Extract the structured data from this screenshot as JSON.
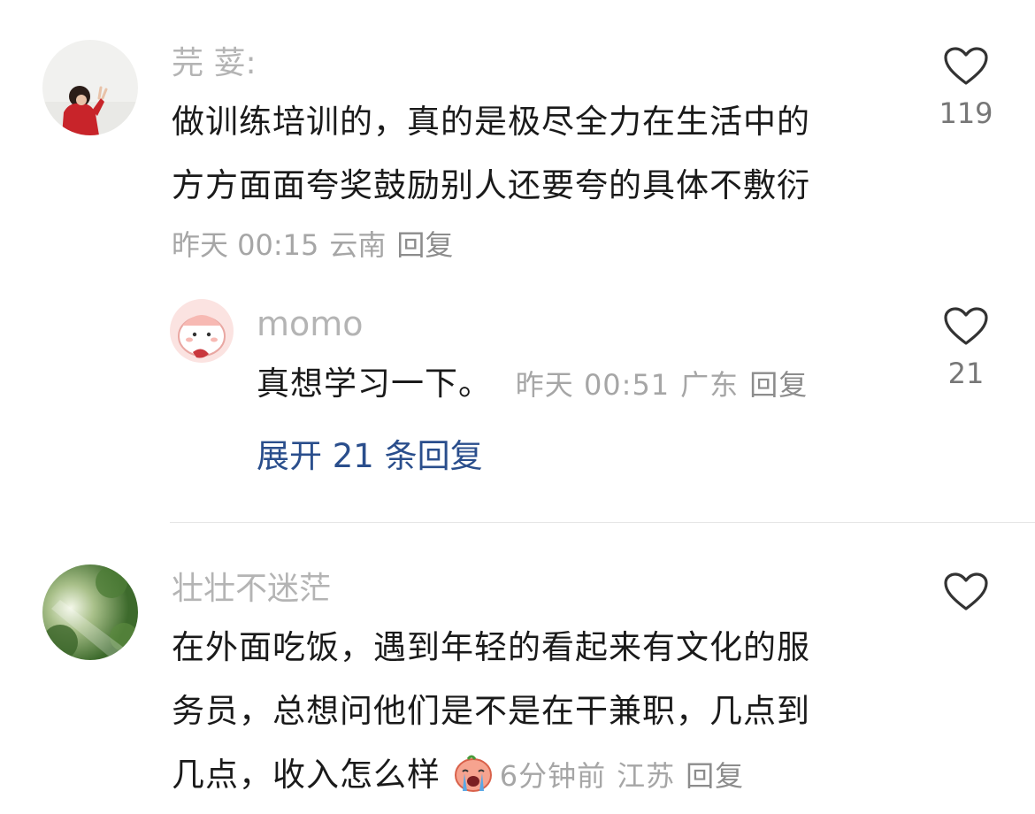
{
  "comments": [
    {
      "username": "芫 荽:",
      "text_line1": "做训练培训的，真的是极尽全力在生活中的",
      "text_line2": "方方面面夸奖鼓励别人还要夸的具体不敷衍",
      "time": "昨天 00:15",
      "location": "云南",
      "reply_label": "回复",
      "like_count": "119",
      "avatar_icon": "person-red-jacket-avatar"
    },
    {
      "username": "壮壮不迷茫",
      "text_line1": "在外面吃饭，遇到年轻的看起来有文化的服",
      "text_line2": "务员，总想问他们是不是在干兼职，几点到",
      "text_line3": "几点，收入怎么样",
      "emoji_icon": "crying-emoji-icon",
      "time": "6分钟前",
      "location": "江苏",
      "reply_label": "回复",
      "avatar_icon": "forest-sunlight-avatar"
    }
  ],
  "reply": {
    "username": "momo",
    "text": "真想学习一下。",
    "time": "昨天 00:51",
    "location": "广东",
    "reply_label": "回复",
    "like_count": "21",
    "avatar_icon": "pink-cartoon-avatar"
  },
  "expand_label": "展开 21 条回复",
  "icons": {
    "like": "heart-outline-icon"
  },
  "colors": {
    "link_blue": "#2a4e8c",
    "meta_gray": "#a6a6a6",
    "username_gray": "#b4b4b4"
  }
}
